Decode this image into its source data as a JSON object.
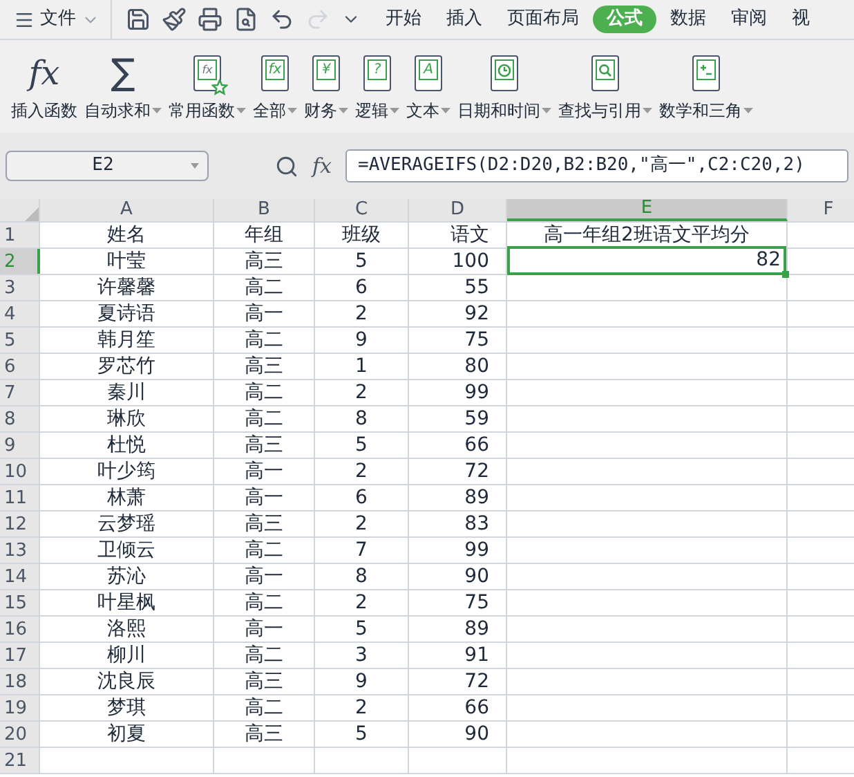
{
  "menu": {
    "label": "文件"
  },
  "quick_access": [
    {
      "kind": "save",
      "disabled": false
    },
    {
      "kind": "paint",
      "disabled": false
    },
    {
      "kind": "print",
      "disabled": false
    },
    {
      "kind": "preview",
      "disabled": false
    },
    {
      "kind": "undo",
      "disabled": false
    },
    {
      "kind": "redo",
      "disabled": true
    },
    {
      "kind": "more",
      "disabled": false
    }
  ],
  "tabs": [
    {
      "label": "开始",
      "selected": false
    },
    {
      "label": "插入",
      "selected": false
    },
    {
      "label": "页面布局",
      "selected": false
    },
    {
      "label": "公式",
      "selected": true
    },
    {
      "label": "数据",
      "selected": false
    },
    {
      "label": "审阅",
      "selected": false
    },
    {
      "label": "视",
      "selected": false
    }
  ],
  "ribbon": [
    {
      "label": "插入函数",
      "kind": "fx",
      "glyph": "fx",
      "dropdown": false
    },
    {
      "label": "自动求和",
      "kind": "sum",
      "glyph": "∑",
      "dropdown": true
    },
    {
      "label": "常用函数",
      "kind": "star-book",
      "glyph": "fx",
      "dropdown": true
    },
    {
      "label": "全部",
      "kind": "text-book",
      "glyph": "fx",
      "dropdown": true
    },
    {
      "label": "财务",
      "kind": "text-book",
      "glyph": "¥",
      "dropdown": true
    },
    {
      "label": "逻辑",
      "kind": "text-book",
      "glyph": "?",
      "dropdown": true
    },
    {
      "label": "文本",
      "kind": "text-book",
      "glyph": "A",
      "dropdown": true
    },
    {
      "label": "日期和时间",
      "kind": "clock-book",
      "dropdown": true
    },
    {
      "label": "查找与引用",
      "kind": "search-book",
      "dropdown": true
    },
    {
      "label": "数学和三角",
      "kind": "math-book",
      "dropdown": true
    }
  ],
  "name_box": "E2",
  "formula_icon": "fx",
  "formula": "=AVERAGEIFS(D2:D20,B2:B20,\"高一\",C2:C20,2)",
  "columns": [
    {
      "label": "A",
      "selected": false
    },
    {
      "label": "B",
      "selected": false
    },
    {
      "label": "C",
      "selected": false
    },
    {
      "label": "D",
      "selected": false
    },
    {
      "label": "E",
      "selected": true
    },
    {
      "label": "F",
      "selected": false
    }
  ],
  "rows": [
    {
      "number": "1",
      "selected": false,
      "cells": [
        "姓名",
        "年组",
        "班级",
        "语文"
      ],
      "e": {
        "text": "高一年组2班语文平均分",
        "selected": false
      }
    },
    {
      "number": "2",
      "selected": true,
      "cells": [
        "叶莹",
        "高三",
        "5",
        "100"
      ],
      "e": {
        "text": "82",
        "selected": true
      }
    },
    {
      "number": "3",
      "selected": false,
      "cells": [
        "许馨馨",
        "高二",
        "6",
        "55"
      ]
    },
    {
      "number": "4",
      "selected": false,
      "cells": [
        "夏诗语",
        "高一",
        "2",
        "92"
      ]
    },
    {
      "number": "5",
      "selected": false,
      "cells": [
        "韩月笙",
        "高二",
        "9",
        "75"
      ]
    },
    {
      "number": "6",
      "selected": false,
      "cells": [
        "罗芯竹",
        "高三",
        "1",
        "80"
      ]
    },
    {
      "number": "7",
      "selected": false,
      "cells": [
        "秦川",
        "高二",
        "2",
        "99"
      ]
    },
    {
      "number": "8",
      "selected": false,
      "cells": [
        "琳欣",
        "高二",
        "8",
        "59"
      ]
    },
    {
      "number": "9",
      "selected": false,
      "cells": [
        "杜悦",
        "高三",
        "5",
        "66"
      ]
    },
    {
      "number": "10",
      "selected": false,
      "cells": [
        "叶少筠",
        "高一",
        "2",
        "72"
      ]
    },
    {
      "number": "11",
      "selected": false,
      "cells": [
        "林萧",
        "高一",
        "6",
        "89"
      ]
    },
    {
      "number": "12",
      "selected": false,
      "cells": [
        "云梦瑶",
        "高三",
        "2",
        "83"
      ]
    },
    {
      "number": "13",
      "selected": false,
      "cells": [
        "卫倾云",
        "高二",
        "7",
        "99"
      ]
    },
    {
      "number": "14",
      "selected": false,
      "cells": [
        "苏沁",
        "高一",
        "8",
        "90"
      ]
    },
    {
      "number": "15",
      "selected": false,
      "cells": [
        "叶星枫",
        "高二",
        "2",
        "75"
      ]
    },
    {
      "number": "16",
      "selected": false,
      "cells": [
        "洛熙",
        "高一",
        "5",
        "89"
      ]
    },
    {
      "number": "17",
      "selected": false,
      "cells": [
        "柳川",
        "高二",
        "3",
        "91"
      ]
    },
    {
      "number": "18",
      "selected": false,
      "cells": [
        "沈良辰",
        "高三",
        "9",
        "72"
      ]
    },
    {
      "number": "19",
      "selected": false,
      "cells": [
        "梦琪",
        "高二",
        "2",
        "66"
      ]
    },
    {
      "number": "20",
      "selected": false,
      "cells": [
        "初夏",
        "高三",
        "5",
        "90"
      ]
    },
    {
      "number": "21",
      "selected": false
    }
  ]
}
